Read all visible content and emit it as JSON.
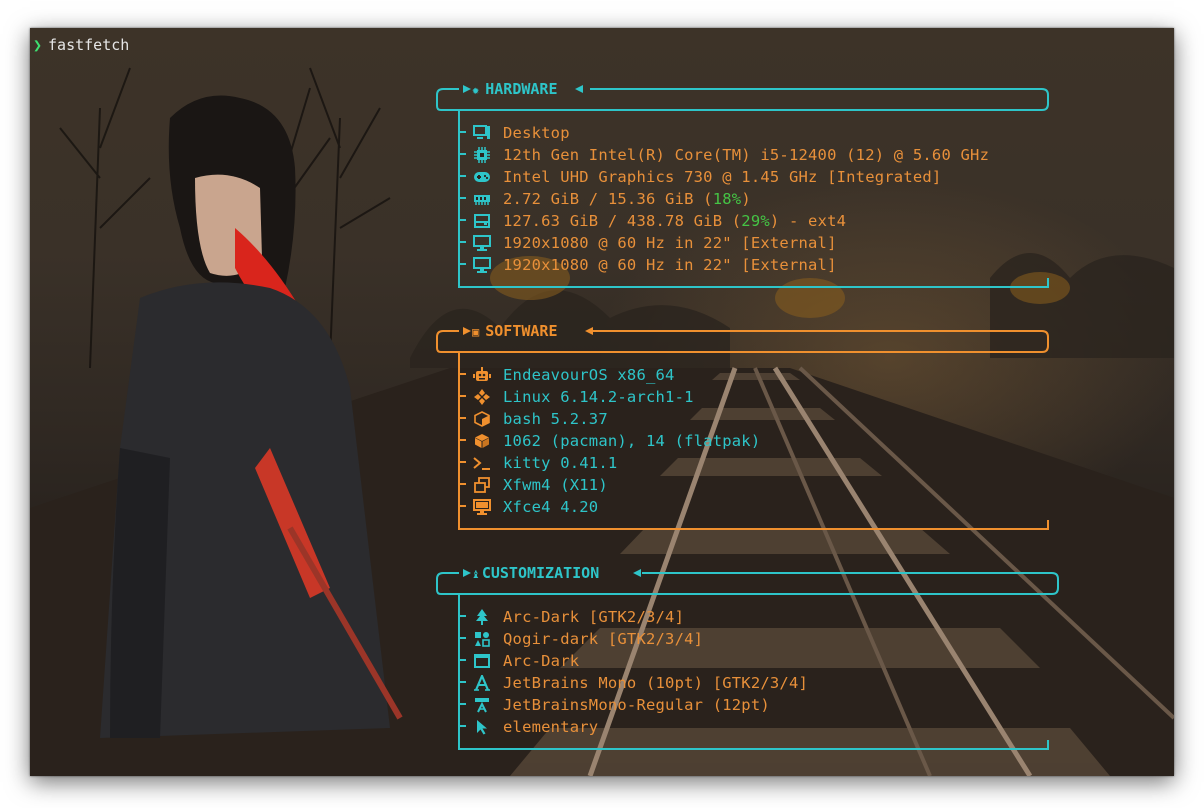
{
  "terminal": {
    "prompt_symbol": "❯",
    "command": "fastfetch"
  },
  "colors": {
    "cyan": "#2ec5c9",
    "orange": "#e8903a",
    "green": "#45c445"
  },
  "hardware": {
    "title": "HARDWARE",
    "icon": "chip-gear-icon",
    "rows": [
      {
        "icon": "desktop-icon",
        "text": "Desktop"
      },
      {
        "icon": "cpu-icon",
        "text": "12th Gen Intel(R) Core(TM) i5-12400 (12) @ 5.60 GHz"
      },
      {
        "icon": "gamepad-icon",
        "text": "Intel UHD Graphics 730 @ 1.45 GHz [Integrated]"
      },
      {
        "icon": "memory-icon",
        "pre": "2.72 GiB / 15.36 GiB (",
        "pct": "18%",
        "post": ")"
      },
      {
        "icon": "disk-icon",
        "pre": "127.63 GiB / 438.78 GiB (",
        "pct": "29%",
        "post": ") - ext4"
      },
      {
        "icon": "monitor-icon",
        "text": "1920x1080 @ 60 Hz in 22\" [External]"
      },
      {
        "icon": "monitor-icon",
        "text": "1920x1080 @ 60 Hz in 22\" [External]"
      }
    ]
  },
  "software": {
    "title": "SOFTWARE",
    "icon": "box-icon",
    "rows": [
      {
        "icon": "robot-icon",
        "text": "EndeavourOS x86_64"
      },
      {
        "icon": "kernel-icon",
        "text": "Linux 6.14.2-arch1-1"
      },
      {
        "icon": "shell-cube-icon",
        "text": "bash 5.2.37"
      },
      {
        "icon": "package-icon",
        "text": "1062 (pacman), 14 (flatpak)"
      },
      {
        "icon": "terminal-icon",
        "text": "kitty 0.41.1"
      },
      {
        "icon": "window-manager-icon",
        "text": "Xfwm4 (X11)"
      },
      {
        "icon": "desktop-environment-icon",
        "text": "Xfce4 4.20"
      }
    ]
  },
  "customization": {
    "title": "CUSTOMIZATION",
    "icon": "paint-roller-icon",
    "rows": [
      {
        "icon": "tree-icon",
        "text": "Arc-Dark [GTK2/3/4]"
      },
      {
        "icon": "icons-grid-icon",
        "text": "Qogir-dark [GTK2/3/4]"
      },
      {
        "icon": "window-theme-icon",
        "text": "Arc-Dark"
      },
      {
        "icon": "font-icon",
        "text": "JetBrains Mono (10pt) [GTK2/3/4]"
      },
      {
        "icon": "terminal-font-icon",
        "text": "JetBrainsMono-Regular (12pt)"
      },
      {
        "icon": "cursor-icon",
        "text": "elementary"
      }
    ]
  }
}
